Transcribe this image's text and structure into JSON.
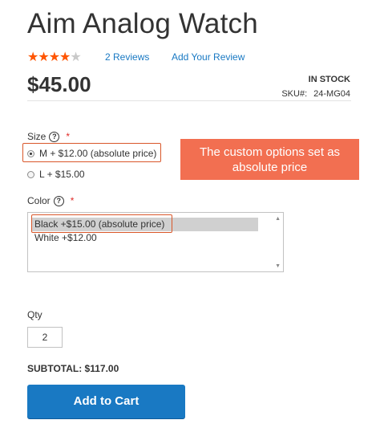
{
  "product": {
    "title": "Aim Analog Watch",
    "rating": {
      "value": 4,
      "max": 5
    },
    "reviews_link": "2  Reviews",
    "add_review_link": "Add Your Review",
    "price": "$45.00",
    "stock_status": "IN STOCK",
    "sku_label": "SKU#:",
    "sku_value": "24-MG04"
  },
  "options": {
    "size": {
      "label": "Size",
      "required_mark": "*",
      "choices": [
        {
          "label": "M + $12.00 (absolute price)",
          "checked": true
        },
        {
          "label": "L + $15.00",
          "checked": false
        }
      ]
    },
    "color": {
      "label": "Color",
      "required_mark": "*",
      "choices": [
        {
          "label": "Black +$15.00 (absolute price)",
          "selected": true
        },
        {
          "label": "White +$12.00",
          "selected": false
        }
      ]
    }
  },
  "annotation": {
    "callout_text": "The custom options set as absolute price",
    "highlight_color": "#d9572a",
    "callout_color": "#f26f51"
  },
  "qty": {
    "label": "Qty",
    "value": "2"
  },
  "subtotal": "SUBTOTAL: $117.00",
  "add_to_cart": "Add to Cart",
  "colors": {
    "accent": "#1979c3",
    "star": "#ff5501"
  }
}
